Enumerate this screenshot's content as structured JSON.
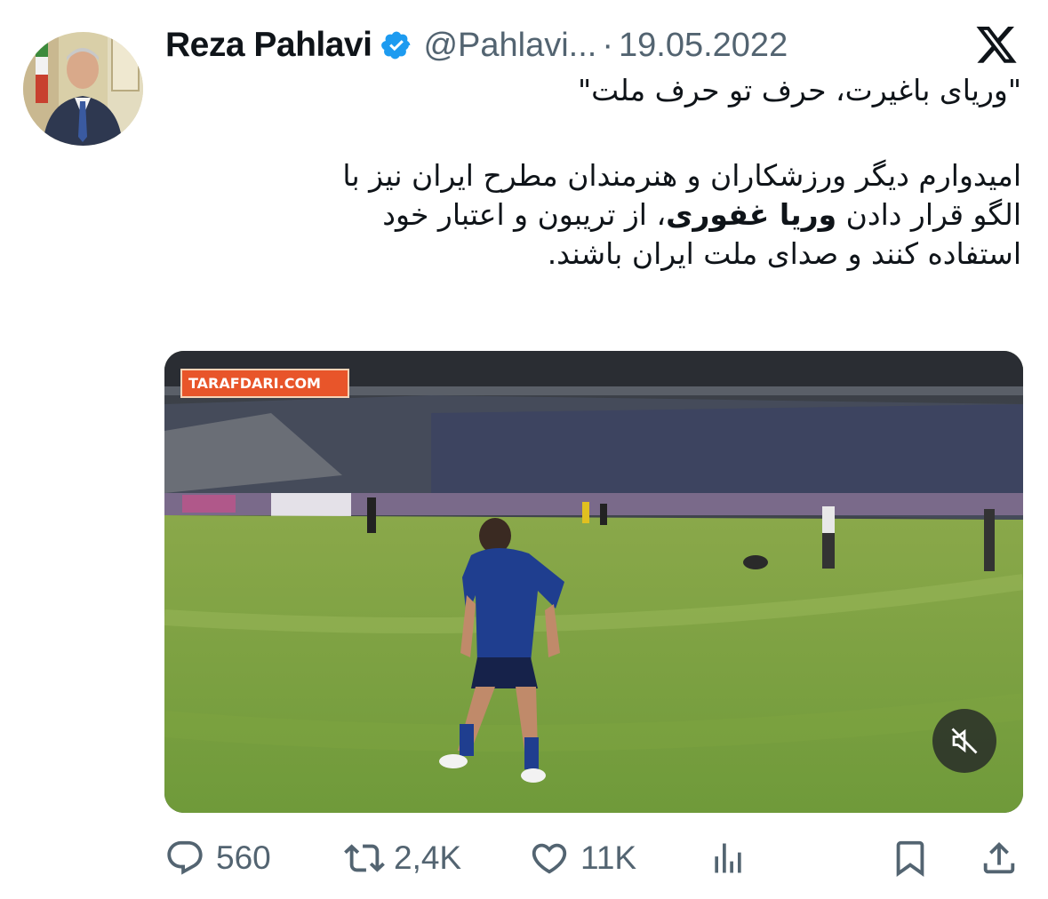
{
  "tweet": {
    "author": {
      "display_name": "Reza Pahlavi",
      "handle": "@Pahlavi...",
      "verified": true
    },
    "separator": "·",
    "date": "19.05.2022",
    "text": {
      "quote": "\"وریای باغیرت، حرف تو حرف ملت\"",
      "line1": "امیدوارم دیگر ورزشکاران و هنرمندان مطرح ایران نیز با",
      "line2_pre": "الگو قرار دادن",
      "line2_bold": "وریا غفوری",
      "line2_post": "، از تریبون و اعتبار خود",
      "line3": "استفاده کنند و صدای ملت ایران باشند."
    },
    "media": {
      "type": "video",
      "watermark": "TARAFDARI.COM",
      "muted": true
    },
    "actions": {
      "replies": "560",
      "retweets": "2,4K",
      "likes": "11K"
    }
  },
  "colors": {
    "text": "#0f1419",
    "secondary": "#536471",
    "verified": "#1d9bf0"
  },
  "icons": [
    "x-logo-icon",
    "verified-badge-icon",
    "mute-icon",
    "reply-icon",
    "retweet-icon",
    "like-icon",
    "views-icon",
    "bookmark-icon",
    "share-icon"
  ]
}
